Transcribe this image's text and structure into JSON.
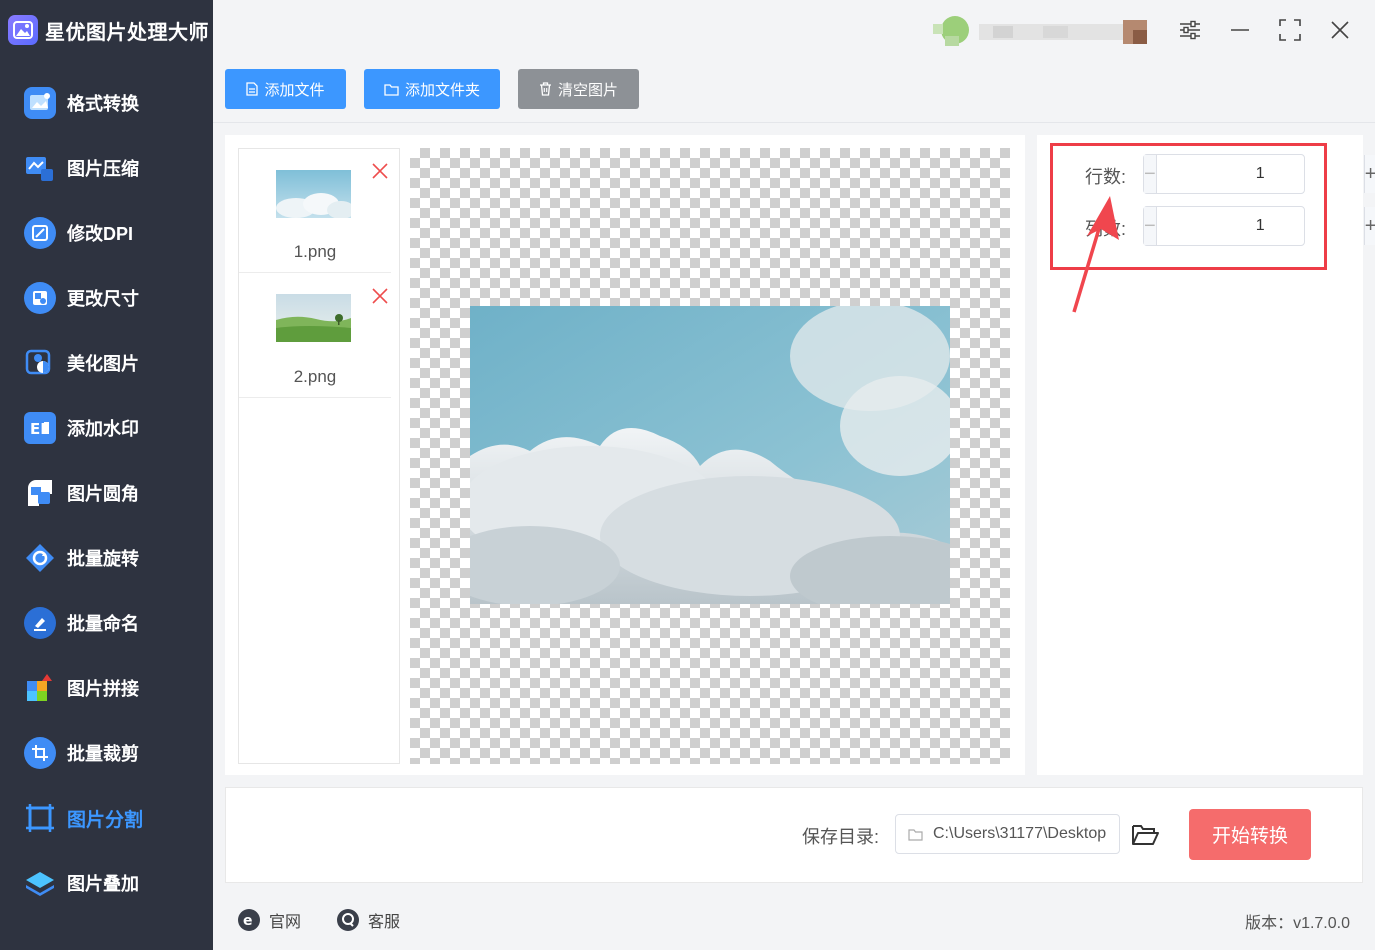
{
  "app": {
    "title": "星优图片处理大师"
  },
  "sidebar": {
    "items": [
      {
        "label": "格式转换",
        "icon": "image-convert-icon"
      },
      {
        "label": "图片压缩",
        "icon": "compress-icon"
      },
      {
        "label": "修改DPI",
        "icon": "dpi-icon"
      },
      {
        "label": "更改尺寸",
        "icon": "resize-icon"
      },
      {
        "label": "美化图片",
        "icon": "beautify-icon"
      },
      {
        "label": "添加水印",
        "icon": "watermark-icon"
      },
      {
        "label": "图片圆角",
        "icon": "round-corner-icon"
      },
      {
        "label": "批量旋转",
        "icon": "rotate-icon"
      },
      {
        "label": "批量命名",
        "icon": "rename-icon"
      },
      {
        "label": "图片拼接",
        "icon": "puzzle-icon"
      },
      {
        "label": "批量裁剪",
        "icon": "crop-icon"
      },
      {
        "label": "图片分割",
        "icon": "split-icon"
      },
      {
        "label": "图片叠加",
        "icon": "layers-icon"
      }
    ],
    "active_index": 11
  },
  "toolbar": {
    "add_file": "添加文件",
    "add_folder": "添加文件夹",
    "clear_images": "清空图片"
  },
  "files": [
    {
      "name": "1.png",
      "thumb": "sky"
    },
    {
      "name": "2.png",
      "thumb": "field"
    }
  ],
  "settings": {
    "rows_label": "行数:",
    "rows_value": "1",
    "cols_label": "列数:",
    "cols_value": "1"
  },
  "output": {
    "save_label": "保存目录:",
    "save_path": "C:\\Users\\31177\\Desktop",
    "start_button": "开始转换"
  },
  "footer": {
    "website": "官网",
    "support": "客服",
    "version": "版本：v1.7.0.0"
  },
  "colors": {
    "sidebar_bg": "#2e3340",
    "accent_blue": "#3c97ff",
    "start_red": "#f56c6c",
    "highlight_red": "#ee3d47"
  }
}
